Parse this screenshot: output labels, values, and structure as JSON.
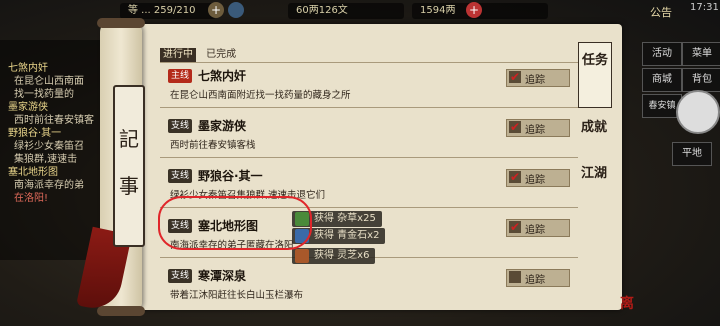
{
  "topbar": {
    "resource_1": "等 ... 259/210",
    "resource_2": "60两126文",
    "resource_3": "1594两",
    "notice_label": "公告",
    "time": "17:31"
  },
  "left_panel": {
    "items": [
      {
        "title": "七煞内奸",
        "desc": "在昆仑山西南面"
      },
      {
        "title": "",
        "desc": "找一找药量的"
      },
      {
        "title": "墨家游侠",
        "desc": "西时前往春安镇客"
      },
      {
        "title": "野狼谷·其一",
        "desc": "绿衫少女秦笛召"
      },
      {
        "title": "",
        "desc": "集狼群,速速击"
      },
      {
        "title": "塞北地形图",
        "desc": "南海派幸存的弟"
      },
      {
        "title": "",
        "desc": "在洛阳!"
      }
    ]
  },
  "right_panel": {
    "buttons": [
      "活动",
      "菜单",
      "商城",
      "背包",
      "春安镇",
      "平地"
    ]
  },
  "journal": {
    "vertical_title": [
      "記",
      "事"
    ],
    "tab_in_progress": "进行中",
    "tab_completed": "已完成",
    "side_tabs": [
      "任务",
      "成就",
      "江湖"
    ],
    "track_label": "追踪",
    "quests": [
      {
        "tag": "主线",
        "tag_type": "main",
        "title": "七煞内奸",
        "desc": "在昆仑山西南面附近找一找药量的藏身之所",
        "tracked": true
      },
      {
        "tag": "支线",
        "tag_type": "side",
        "title": "墨家游侠",
        "desc": "西时前往春安镇客栈",
        "tracked": true
      },
      {
        "tag": "支线",
        "tag_type": "side",
        "title": "野狼谷·其一",
        "desc": "绿衫少女秦笛召集狼群,速速击退它们",
        "tracked": true
      },
      {
        "tag": "支线",
        "tag_type": "side",
        "title": "塞北地形图",
        "desc": "南海派幸存的弟子匿藏在洛阳",
        "tracked": true
      },
      {
        "tag": "支线",
        "tag_type": "side",
        "title": "寒潭深泉",
        "desc": "带着江沐阳赶往长白山玉栏瀑布",
        "tracked": false
      }
    ],
    "rewards": [
      {
        "label": "获得 杂草x25",
        "icon_color": "#4a8a3a"
      },
      {
        "label": "获得 青金石x2",
        "icon_color": "#3a6aa8"
      },
      {
        "label": "获得 灵芝x6",
        "icon_color": "#a8582a"
      }
    ]
  },
  "logo_text": "离开"
}
